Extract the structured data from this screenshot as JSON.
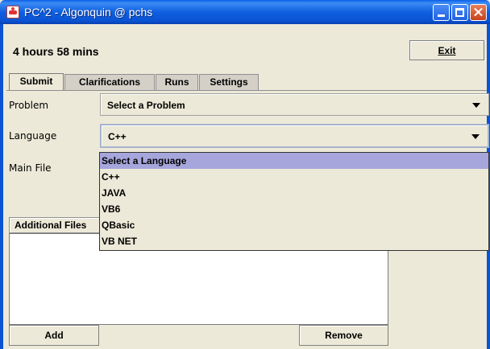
{
  "window": {
    "title": "PC^2 - Algonquin @ pchs"
  },
  "header": {
    "time_remaining": "4 hours 58 mins",
    "exit_label": "Exit"
  },
  "tabs": [
    {
      "label": "Submit",
      "active": true
    },
    {
      "label": "Clarifications",
      "active": false
    },
    {
      "label": "Runs",
      "active": false
    },
    {
      "label": "Settings",
      "active": false
    }
  ],
  "form": {
    "problem_label": "Problem",
    "problem_value": "Select a Problem",
    "language_label": "Language",
    "language_value": "C++",
    "main_file_label": "Main File"
  },
  "language_dropdown": {
    "options": [
      "Select a Language",
      "C++",
      "JAVA",
      "VB6",
      "QBasic",
      "VB NET"
    ],
    "highlighted_index": 0
  },
  "files": {
    "header": "Additional Files",
    "add_label": "Add",
    "remove_label": "Remove"
  },
  "colors": {
    "titlebar": "#0a54d4",
    "dialog_bg": "#ece9d8",
    "highlight": "#a6a6dc"
  }
}
